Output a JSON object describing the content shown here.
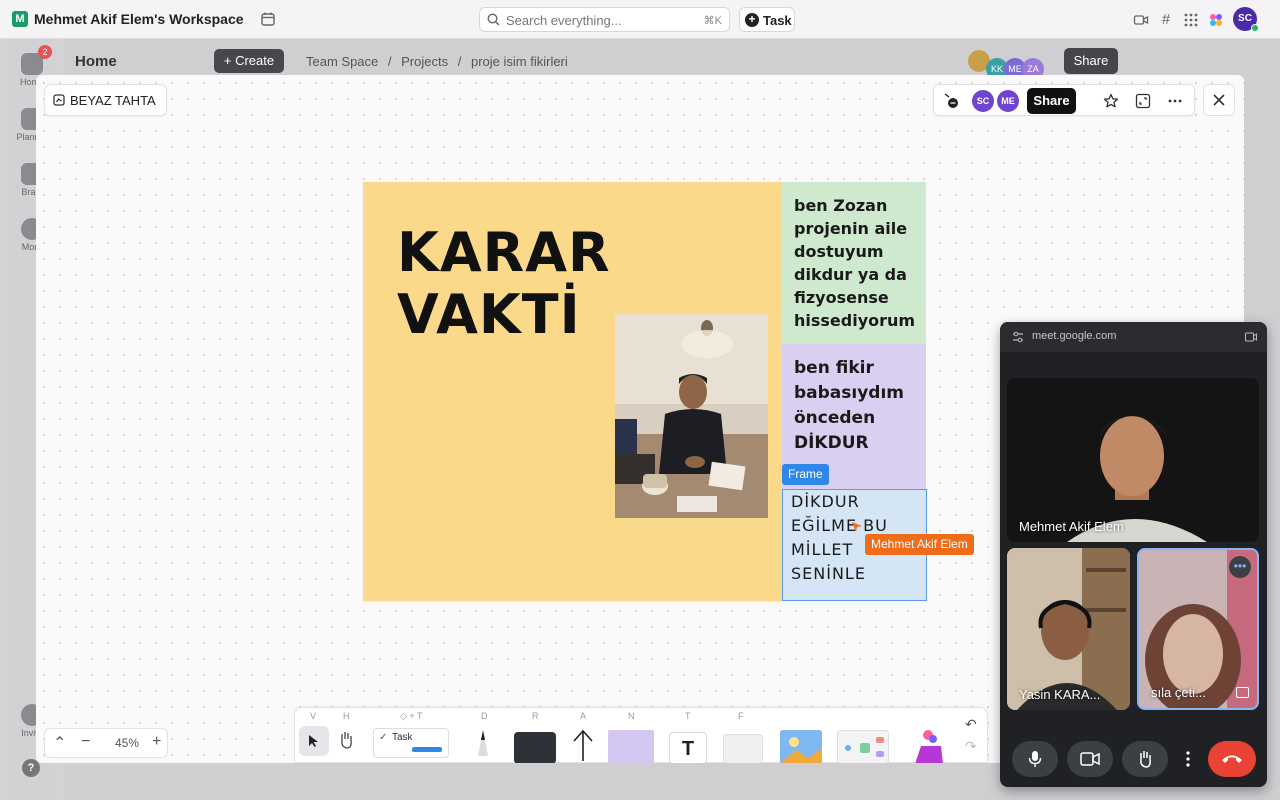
{
  "topbar": {
    "workspace_initial": "M",
    "workspace_name": "Mehmet Akif Elem's Workspace",
    "search_placeholder": "Search everything...",
    "search_shortcut": "⌘K",
    "task_label": "Task",
    "user_initials": "SC"
  },
  "rail": {
    "badge": "2",
    "items": [
      "Home",
      "Planner",
      "Brain",
      "More"
    ],
    "invite": "Invite",
    "help": "?"
  },
  "background_page": {
    "title": "Home",
    "create_label": "+ Create",
    "breadcrumb": [
      "Team Space",
      "/",
      "Projects",
      "/",
      "proje isim fikirleri"
    ],
    "share_label": "Share",
    "avatars": [
      "",
      "KK",
      "ME",
      "ZA"
    ]
  },
  "whiteboard": {
    "title": "BEYAZ TAHTA",
    "share_label": "Share",
    "avatars": [
      "SC",
      "ME"
    ],
    "main_frame_title_line1": "KARAR",
    "main_frame_title_line2": "VAKTİ",
    "note_green": "ben Zozan projenin aile dostuyum dikdur ya da fizyosense hissediyorum",
    "note_purple": "ben fikir babasıydım önceden DİKDUR",
    "note_blue": "DİKDUR EĞİLME BU MİLLET SENİNLE",
    "frame_label": "Frame",
    "cursor_user": "Mehmet Akif Elem",
    "zoom_level": "45%",
    "toolbar_keys": [
      "V",
      "H",
      "◇ + T",
      "D",
      "R",
      "A",
      "N",
      "T",
      "F"
    ],
    "toolbar_task_label": "Task"
  },
  "meet": {
    "url": "meet.google.com",
    "participants": [
      "Mehmet Akif Elem",
      "Yasin KARA...",
      "sıla çeti..."
    ]
  }
}
